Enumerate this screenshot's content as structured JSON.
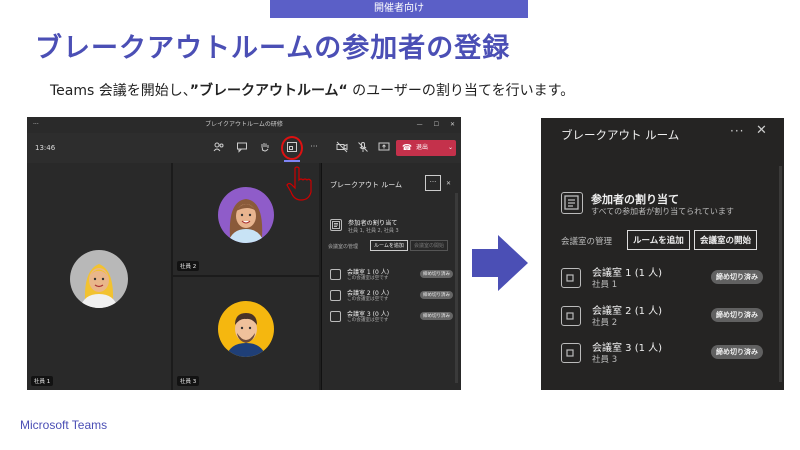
{
  "header": {
    "tag": "開催者向け",
    "title": "ブレークアウトルームの参加者の登録",
    "subtitle_pre": "Teams 会議を開始し、",
    "subtitle_em": "”ブレークアウトルーム“",
    "subtitle_post": " のユーザーの割り当てを行います。"
  },
  "footer": {
    "brand": "Microsoft Teams"
  },
  "meeting_window": {
    "title": "ブレイクアウトルームの研修",
    "menu_dots": "···",
    "clock": "13:46",
    "leave_label": "退出",
    "tiles": [
      {
        "label": "社員 1"
      },
      {
        "label": "社員 2"
      },
      {
        "label": "社員 3"
      }
    ],
    "panel": {
      "title": "ブレークアウト ルーム",
      "more": "···",
      "close": "✕",
      "assign_title": "参加者の割り当て",
      "assign_sub": "社員 1, 社員 2, 社員 3",
      "management": "会議室の管理",
      "add_room": "ルームを追加",
      "start_rooms": "会議室の開始",
      "rooms": [
        {
          "name": "会議室 1 (0 人)",
          "sub": "この会議室は空です",
          "badge": "締め切り済み"
        },
        {
          "name": "会議室 2 (0 人)",
          "sub": "この会議室は空です",
          "badge": "締め切り済み"
        },
        {
          "name": "会議室 3 (0 人)",
          "sub": "この会議室は空です",
          "badge": "締め切り済み"
        }
      ]
    }
  },
  "breakout_panel": {
    "title": "ブレークアウト ルーム",
    "more": "···",
    "close": "✕",
    "assign_title": "参加者の割り当て",
    "assign_sub": "すべての参加者が割り当てられています",
    "management": "会議室の管理",
    "add_room": "ルームを追加",
    "start_rooms": "会議室の開始",
    "rooms": [
      {
        "name": "会議室 1 (1 人)",
        "member": "社員 1",
        "badge": "締め切り済み"
      },
      {
        "name": "会議室 2 (1 人)",
        "member": "社員 2",
        "badge": "締め切り済み"
      },
      {
        "name": "会議室 3 (1 人)",
        "member": "社員 3",
        "badge": "締め切り済み"
      }
    ]
  },
  "colors": {
    "accent": "#4b4fb5",
    "leave": "#c4314b",
    "highlight": "#dd1111"
  }
}
